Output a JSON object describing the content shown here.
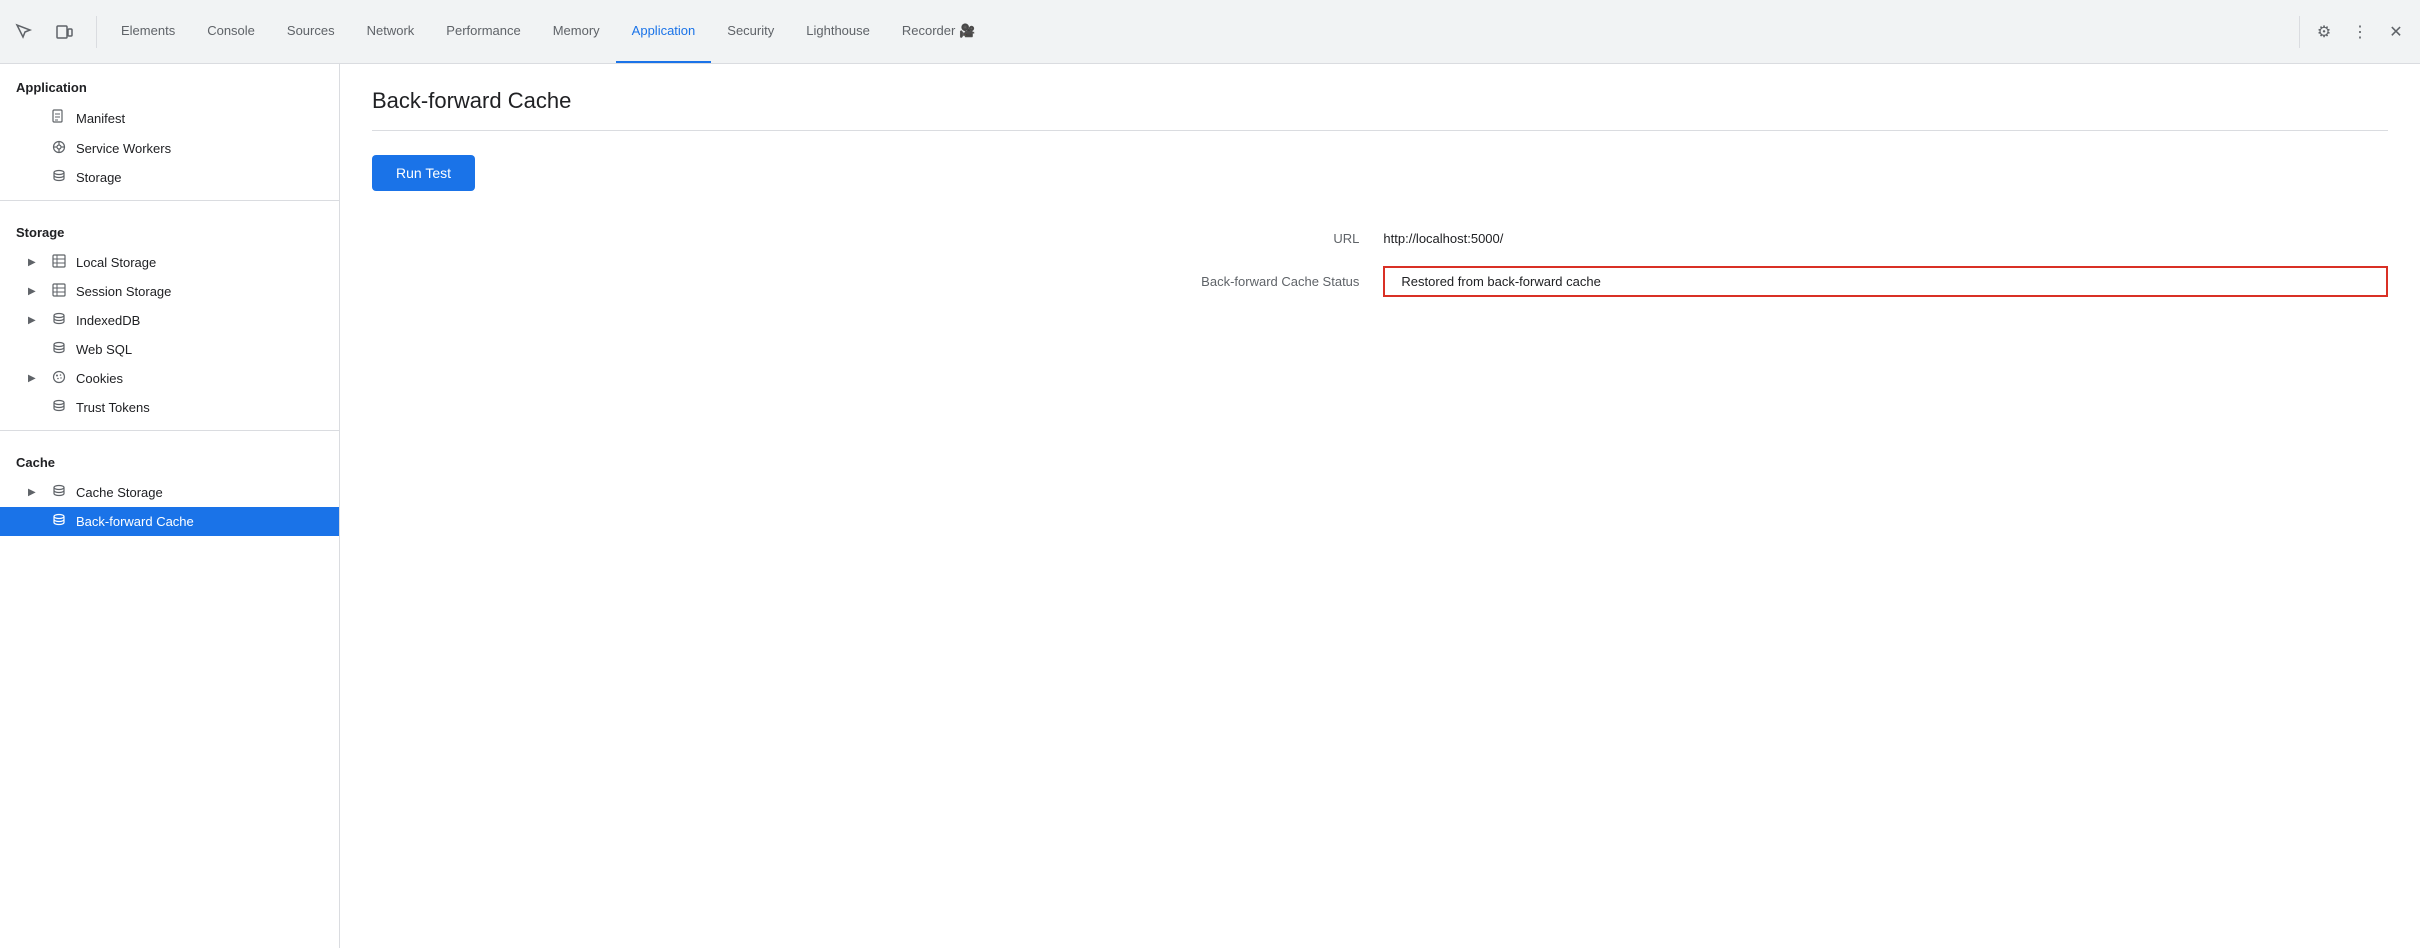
{
  "toolbar": {
    "tabs": [
      {
        "id": "elements",
        "label": "Elements",
        "active": false
      },
      {
        "id": "console",
        "label": "Console",
        "active": false
      },
      {
        "id": "sources",
        "label": "Sources",
        "active": false
      },
      {
        "id": "network",
        "label": "Network",
        "active": false
      },
      {
        "id": "performance",
        "label": "Performance",
        "active": false
      },
      {
        "id": "memory",
        "label": "Memory",
        "active": false
      },
      {
        "id": "application",
        "label": "Application",
        "active": true
      },
      {
        "id": "security",
        "label": "Security",
        "active": false
      },
      {
        "id": "lighthouse",
        "label": "Lighthouse",
        "active": false
      },
      {
        "id": "recorder",
        "label": "Recorder 🎥",
        "active": false
      }
    ]
  },
  "sidebar": {
    "sections": [
      {
        "label": "Application",
        "items": [
          {
            "id": "manifest",
            "label": "Manifest",
            "icon": "📄",
            "hasArrow": false
          },
          {
            "id": "service-workers",
            "label": "Service Workers",
            "icon": "⚙",
            "hasArrow": false
          },
          {
            "id": "storage",
            "label": "Storage",
            "icon": "🗄",
            "hasArrow": false
          }
        ]
      },
      {
        "label": "Storage",
        "items": [
          {
            "id": "local-storage",
            "label": "Local Storage",
            "icon": "▦",
            "hasArrow": true
          },
          {
            "id": "session-storage",
            "label": "Session Storage",
            "icon": "▦",
            "hasArrow": true
          },
          {
            "id": "indexeddb",
            "label": "IndexedDB",
            "icon": "🗄",
            "hasArrow": true
          },
          {
            "id": "web-sql",
            "label": "Web SQL",
            "icon": "🗄",
            "hasArrow": false
          },
          {
            "id": "cookies",
            "label": "Cookies",
            "icon": "✿",
            "hasArrow": true
          },
          {
            "id": "trust-tokens",
            "label": "Trust Tokens",
            "icon": "🗄",
            "hasArrow": false
          }
        ]
      },
      {
        "label": "Cache",
        "items": [
          {
            "id": "cache-storage",
            "label": "Cache Storage",
            "icon": "🗄",
            "hasArrow": true
          },
          {
            "id": "back-forward-cache",
            "label": "Back-forward Cache",
            "icon": "🗄",
            "hasArrow": false,
            "active": true
          }
        ]
      }
    ]
  },
  "main": {
    "title": "Back-forward Cache",
    "run_test_label": "Run Test",
    "url_label": "URL",
    "url_value": "http://localhost:5000/",
    "cache_status_label": "Back-forward Cache Status",
    "cache_status_value": "Restored from back-forward cache"
  }
}
